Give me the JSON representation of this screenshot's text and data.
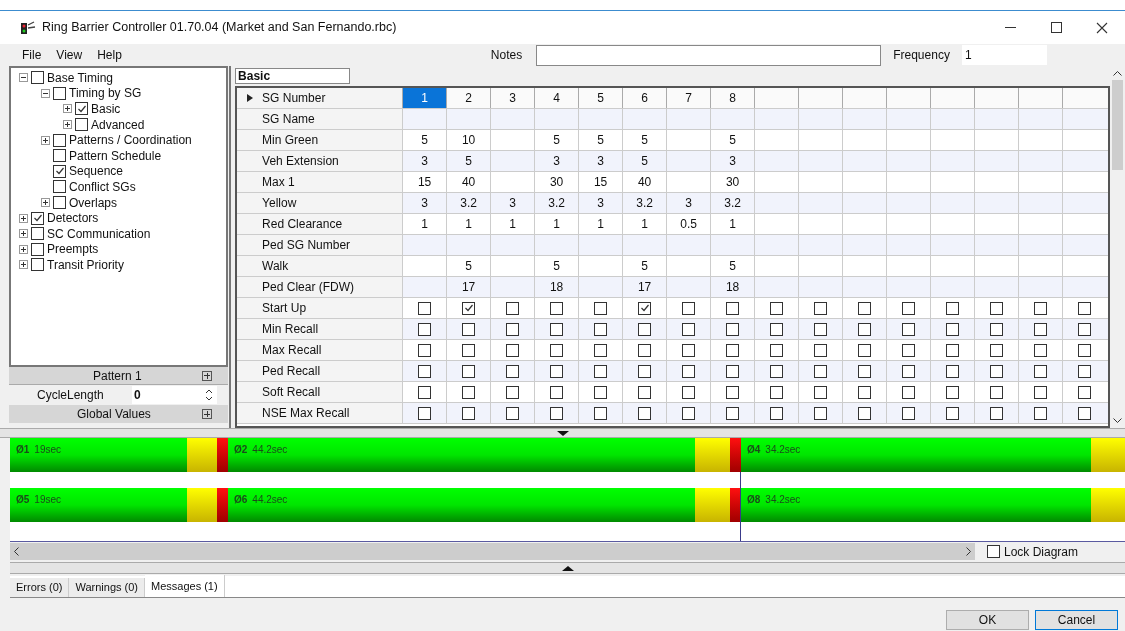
{
  "window": {
    "title": "Ring Barrier Controller 01.70.04 (Market and San Fernando.rbc)"
  },
  "menu": [
    "File",
    "View",
    "Help"
  ],
  "notes": {
    "label": "Notes"
  },
  "frequency": {
    "label": "Frequency",
    "value": "1"
  },
  "tree": [
    {
      "label": "Base Timing",
      "checked": false,
      "expanded": true,
      "children": [
        {
          "label": "Timing by SG",
          "checked": false,
          "expanded": true,
          "children": [
            {
              "label": "Basic",
              "checked": true,
              "expanded": false
            },
            {
              "label": "Advanced",
              "checked": false,
              "expanded": false
            }
          ]
        },
        {
          "label": "Patterns / Coordination",
          "checked": false,
          "expanded": false
        },
        {
          "label": "Pattern Schedule",
          "checked": false
        },
        {
          "label": "Sequence",
          "checked": true
        },
        {
          "label": "Conflict SGs",
          "checked": false
        },
        {
          "label": "Overlaps",
          "checked": false,
          "expanded": false
        }
      ]
    },
    {
      "label": "Detectors",
      "checked": true,
      "expanded": false
    },
    {
      "label": "SC Communication",
      "checked": false,
      "expanded": false
    },
    {
      "label": "Preempts",
      "checked": false,
      "expanded": false
    },
    {
      "label": "Transit Priority",
      "checked": false,
      "expanded": false
    }
  ],
  "pattern": {
    "label": "Pattern 1"
  },
  "cycle_length": {
    "label": "CycleLength",
    "value": "0"
  },
  "global_values": {
    "label": "Global Values"
  },
  "grid": {
    "title": "Basic",
    "header": {
      "label": "SG Number",
      "numbers": [
        {
          "text": "1",
          "selected": true
        },
        {
          "text": "2",
          "selected": false
        },
        {
          "text": "3",
          "selected": false
        },
        {
          "text": "4",
          "selected": false
        },
        {
          "text": "5",
          "selected": false
        },
        {
          "text": "6",
          "selected": false
        },
        {
          "text": "7",
          "selected": false
        },
        {
          "text": "8",
          "selected": false
        }
      ]
    },
    "rows": [
      {
        "kind": "text",
        "label": "SG Name",
        "cells": [
          null,
          null,
          null,
          null,
          null,
          null,
          null,
          null
        ]
      },
      {
        "kind": "text",
        "label": "Min Green",
        "cells": [
          "5",
          "10",
          null,
          "5",
          "5",
          "5",
          null,
          "5"
        ]
      },
      {
        "kind": "text",
        "label": "Veh Extension",
        "cells": [
          "3",
          "5",
          null,
          "3",
          "3",
          "5",
          null,
          "3"
        ]
      },
      {
        "kind": "text",
        "label": "Max 1",
        "cells": [
          "15",
          "40",
          null,
          "30",
          "15",
          "40",
          null,
          "30"
        ]
      },
      {
        "kind": "text",
        "label": "Yellow",
        "cells": [
          "3",
          "3.2",
          "3",
          "3.2",
          "3",
          "3.2",
          "3",
          "3.2"
        ]
      },
      {
        "kind": "text",
        "label": "Red Clearance",
        "cells": [
          "1",
          "1",
          "1",
          "1",
          "1",
          "1",
          "0.5",
          "1"
        ]
      },
      {
        "kind": "text",
        "label": "Ped SG Number",
        "cells": [
          null,
          null,
          null,
          null,
          null,
          null,
          null,
          null
        ]
      },
      {
        "kind": "text",
        "label": "Walk",
        "cells": [
          null,
          "5",
          null,
          "5",
          null,
          "5",
          null,
          "5"
        ]
      },
      {
        "kind": "text",
        "label": "Ped Clear (FDW)",
        "cells": [
          null,
          "17",
          null,
          "18",
          null,
          "17",
          null,
          "18"
        ]
      },
      {
        "kind": "check",
        "label": "Start Up",
        "checks": [
          false,
          true,
          false,
          false,
          false,
          true,
          false,
          false,
          false,
          false,
          false,
          false,
          false,
          false,
          false,
          false
        ]
      },
      {
        "kind": "check",
        "label": "Min Recall",
        "checks": [
          false,
          false,
          false,
          false,
          false,
          false,
          false,
          false,
          false,
          false,
          false,
          false,
          false,
          false,
          false,
          false
        ]
      },
      {
        "kind": "check",
        "label": "Max Recall",
        "checks": [
          false,
          false,
          false,
          false,
          false,
          false,
          false,
          false,
          false,
          false,
          false,
          false,
          false,
          false,
          false,
          false
        ]
      },
      {
        "kind": "check",
        "label": "Ped Recall",
        "checks": [
          false,
          false,
          false,
          false,
          false,
          false,
          false,
          false,
          false,
          false,
          false,
          false,
          false,
          false,
          false,
          false
        ]
      },
      {
        "kind": "check",
        "label": "Soft Recall",
        "checks": [
          false,
          false,
          false,
          false,
          false,
          false,
          false,
          false,
          false,
          false,
          false,
          false,
          false,
          false,
          false,
          false
        ]
      },
      {
        "kind": "check",
        "label": "NSE Max Recall",
        "checks": [
          false,
          false,
          false,
          false,
          false,
          false,
          false,
          false,
          false,
          false,
          false,
          false,
          false,
          false,
          false,
          false
        ]
      }
    ]
  },
  "rings": [
    {
      "phases": [
        {
          "symbol": "Ø1",
          "duration": "19sec"
        },
        {
          "symbol": "Ø2",
          "duration": "44.2sec"
        },
        {
          "symbol": "Ø4",
          "duration": "34.2sec"
        }
      ]
    },
    {
      "phases": [
        {
          "symbol": "Ø5",
          "duration": "19sec"
        },
        {
          "symbol": "Ø6",
          "duration": "44.2sec"
        },
        {
          "symbol": "Ø8",
          "duration": "34.2sec"
        }
      ]
    }
  ],
  "lock_diagram": {
    "label": "Lock Diagram",
    "checked": false
  },
  "tabs": [
    {
      "label": "Errors (0)",
      "selected": false
    },
    {
      "label": "Warnings (0)",
      "selected": false
    },
    {
      "label": "Messages (1)",
      "selected": true
    }
  ],
  "buttons": [
    "OK",
    "Cancel"
  ]
}
